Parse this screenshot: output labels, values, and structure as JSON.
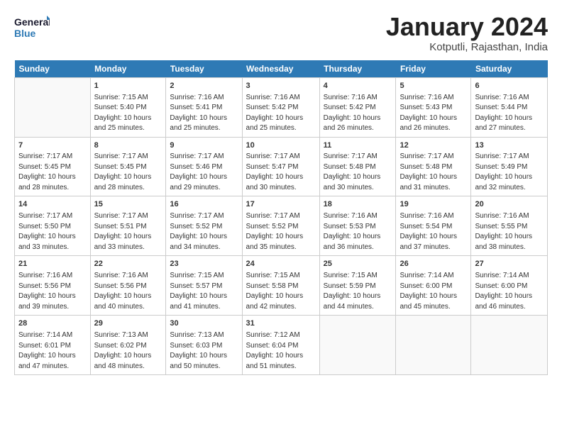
{
  "header": {
    "logo_general": "General",
    "logo_blue": "Blue",
    "month_title": "January 2024",
    "location": "Kotputli, Rajasthan, India"
  },
  "days_of_week": [
    "Sunday",
    "Monday",
    "Tuesday",
    "Wednesday",
    "Thursday",
    "Friday",
    "Saturday"
  ],
  "weeks": [
    [
      {
        "day": "",
        "content": ""
      },
      {
        "day": "1",
        "content": "Sunrise: 7:15 AM\nSunset: 5:40 PM\nDaylight: 10 hours\nand 25 minutes."
      },
      {
        "day": "2",
        "content": "Sunrise: 7:16 AM\nSunset: 5:41 PM\nDaylight: 10 hours\nand 25 minutes."
      },
      {
        "day": "3",
        "content": "Sunrise: 7:16 AM\nSunset: 5:42 PM\nDaylight: 10 hours\nand 25 minutes."
      },
      {
        "day": "4",
        "content": "Sunrise: 7:16 AM\nSunset: 5:42 PM\nDaylight: 10 hours\nand 26 minutes."
      },
      {
        "day": "5",
        "content": "Sunrise: 7:16 AM\nSunset: 5:43 PM\nDaylight: 10 hours\nand 26 minutes."
      },
      {
        "day": "6",
        "content": "Sunrise: 7:16 AM\nSunset: 5:44 PM\nDaylight: 10 hours\nand 27 minutes."
      }
    ],
    [
      {
        "day": "7",
        "content": "Sunrise: 7:17 AM\nSunset: 5:45 PM\nDaylight: 10 hours\nand 28 minutes."
      },
      {
        "day": "8",
        "content": "Sunrise: 7:17 AM\nSunset: 5:45 PM\nDaylight: 10 hours\nand 28 minutes."
      },
      {
        "day": "9",
        "content": "Sunrise: 7:17 AM\nSunset: 5:46 PM\nDaylight: 10 hours\nand 29 minutes."
      },
      {
        "day": "10",
        "content": "Sunrise: 7:17 AM\nSunset: 5:47 PM\nDaylight: 10 hours\nand 30 minutes."
      },
      {
        "day": "11",
        "content": "Sunrise: 7:17 AM\nSunset: 5:48 PM\nDaylight: 10 hours\nand 30 minutes."
      },
      {
        "day": "12",
        "content": "Sunrise: 7:17 AM\nSunset: 5:48 PM\nDaylight: 10 hours\nand 31 minutes."
      },
      {
        "day": "13",
        "content": "Sunrise: 7:17 AM\nSunset: 5:49 PM\nDaylight: 10 hours\nand 32 minutes."
      }
    ],
    [
      {
        "day": "14",
        "content": "Sunrise: 7:17 AM\nSunset: 5:50 PM\nDaylight: 10 hours\nand 33 minutes."
      },
      {
        "day": "15",
        "content": "Sunrise: 7:17 AM\nSunset: 5:51 PM\nDaylight: 10 hours\nand 33 minutes."
      },
      {
        "day": "16",
        "content": "Sunrise: 7:17 AM\nSunset: 5:52 PM\nDaylight: 10 hours\nand 34 minutes."
      },
      {
        "day": "17",
        "content": "Sunrise: 7:17 AM\nSunset: 5:52 PM\nDaylight: 10 hours\nand 35 minutes."
      },
      {
        "day": "18",
        "content": "Sunrise: 7:16 AM\nSunset: 5:53 PM\nDaylight: 10 hours\nand 36 minutes."
      },
      {
        "day": "19",
        "content": "Sunrise: 7:16 AM\nSunset: 5:54 PM\nDaylight: 10 hours\nand 37 minutes."
      },
      {
        "day": "20",
        "content": "Sunrise: 7:16 AM\nSunset: 5:55 PM\nDaylight: 10 hours\nand 38 minutes."
      }
    ],
    [
      {
        "day": "21",
        "content": "Sunrise: 7:16 AM\nSunset: 5:56 PM\nDaylight: 10 hours\nand 39 minutes."
      },
      {
        "day": "22",
        "content": "Sunrise: 7:16 AM\nSunset: 5:56 PM\nDaylight: 10 hours\nand 40 minutes."
      },
      {
        "day": "23",
        "content": "Sunrise: 7:15 AM\nSunset: 5:57 PM\nDaylight: 10 hours\nand 41 minutes."
      },
      {
        "day": "24",
        "content": "Sunrise: 7:15 AM\nSunset: 5:58 PM\nDaylight: 10 hours\nand 42 minutes."
      },
      {
        "day": "25",
        "content": "Sunrise: 7:15 AM\nSunset: 5:59 PM\nDaylight: 10 hours\nand 44 minutes."
      },
      {
        "day": "26",
        "content": "Sunrise: 7:14 AM\nSunset: 6:00 PM\nDaylight: 10 hours\nand 45 minutes."
      },
      {
        "day": "27",
        "content": "Sunrise: 7:14 AM\nSunset: 6:00 PM\nDaylight: 10 hours\nand 46 minutes."
      }
    ],
    [
      {
        "day": "28",
        "content": "Sunrise: 7:14 AM\nSunset: 6:01 PM\nDaylight: 10 hours\nand 47 minutes."
      },
      {
        "day": "29",
        "content": "Sunrise: 7:13 AM\nSunset: 6:02 PM\nDaylight: 10 hours\nand 48 minutes."
      },
      {
        "day": "30",
        "content": "Sunrise: 7:13 AM\nSunset: 6:03 PM\nDaylight: 10 hours\nand 50 minutes."
      },
      {
        "day": "31",
        "content": "Sunrise: 7:12 AM\nSunset: 6:04 PM\nDaylight: 10 hours\nand 51 minutes."
      },
      {
        "day": "",
        "content": ""
      },
      {
        "day": "",
        "content": ""
      },
      {
        "day": "",
        "content": ""
      }
    ]
  ]
}
